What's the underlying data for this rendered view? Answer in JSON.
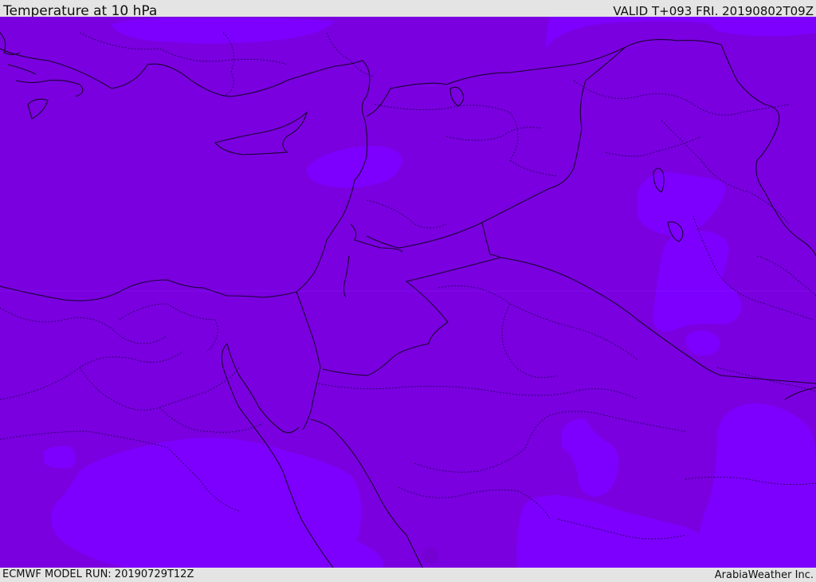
{
  "header": {
    "title": "Temperature at 10 hPa",
    "valid_time": "VALID T+093 FRI. 20190802T09Z"
  },
  "footer": {
    "model_run": "ECMWF MODEL RUN: 20190729T12Z",
    "credit": "ArabiaWeather Inc."
  },
  "map": {
    "colors": {
      "base_fill": "#7a00e0",
      "warm_patch_fill": "#7d00ff",
      "border_line": "#1a0030",
      "dotted_line": "#2a0060"
    }
  }
}
